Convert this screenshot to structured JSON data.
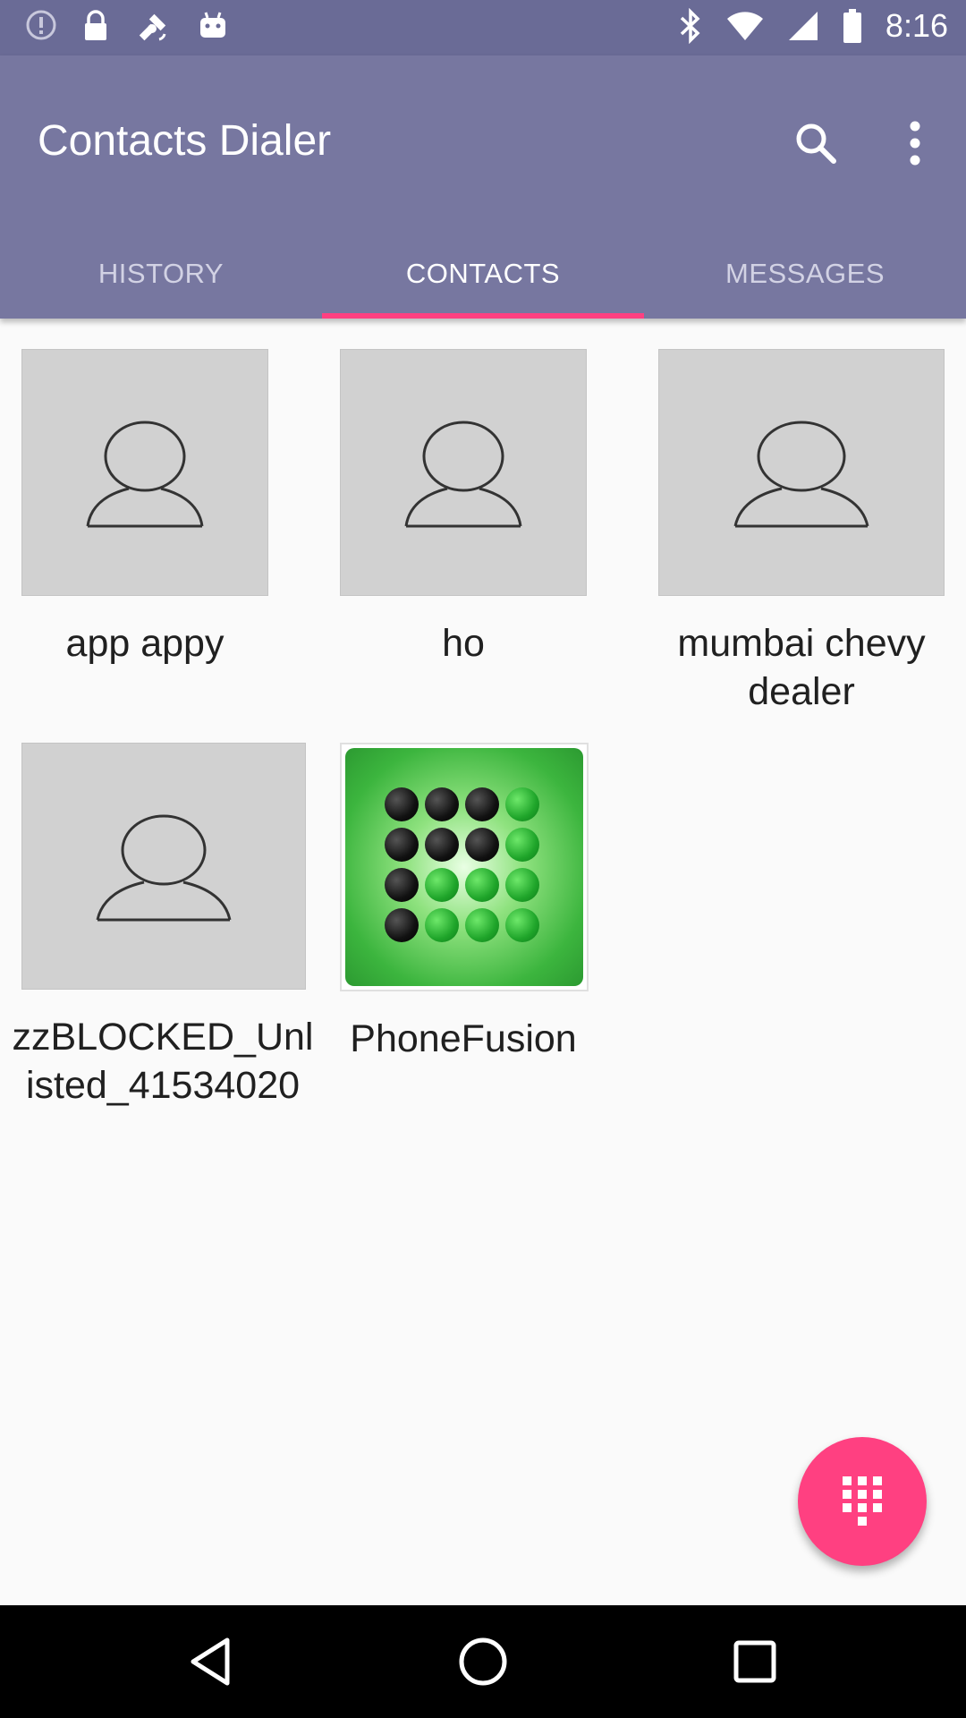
{
  "status_bar": {
    "time": "8:16",
    "left_icons": [
      "alert-icon",
      "lock-icon",
      "satellite-icon",
      "android-icon"
    ],
    "right_icons": [
      "bluetooth-icon",
      "wifi-icon",
      "signal-icon",
      "battery-icon"
    ]
  },
  "app_bar": {
    "title": "Contacts Dialer",
    "actions": [
      "search-icon",
      "more-vert-icon"
    ]
  },
  "tabs": [
    {
      "label": "HISTORY",
      "active": false
    },
    {
      "label": "CONTACTS",
      "active": true
    },
    {
      "label": "MESSAGES",
      "active": false
    }
  ],
  "contacts": [
    {
      "name": "app appy",
      "image": "person-placeholder-icon"
    },
    {
      "name": "ho",
      "image": "person-placeholder-icon"
    },
    {
      "name": "mumbai chevy dealer",
      "image": "person-placeholder-icon"
    },
    {
      "name": "zzBLOCKED_Unlisted_41534020",
      "image": "person-placeholder-icon"
    },
    {
      "name": "PhoneFusion",
      "image": "phonefusion-logo"
    }
  ],
  "fab": {
    "icon": "dialpad-icon"
  },
  "nav_bar": {
    "buttons": [
      "back-icon",
      "home-icon",
      "recents-icon"
    ]
  },
  "colors": {
    "status_bar": "#6a6b96",
    "app_bar": "#7777a0",
    "accent": "#ff4081",
    "avatar_bg": "#d1d1d1"
  }
}
